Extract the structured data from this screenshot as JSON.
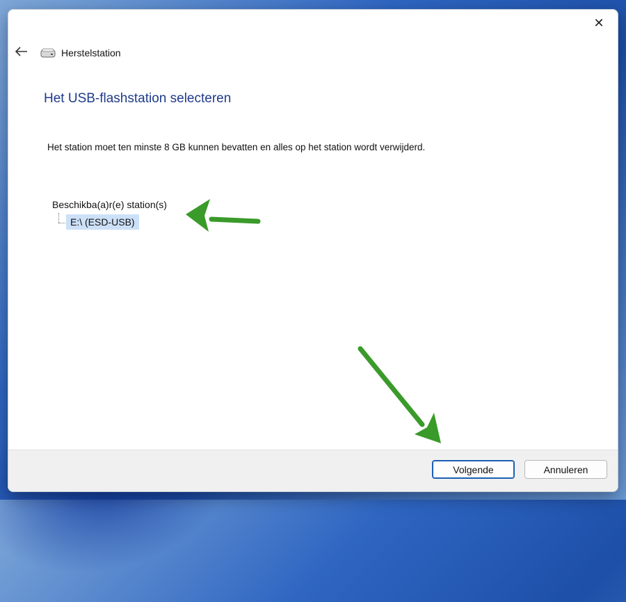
{
  "window": {
    "app_title": "Herstelstation",
    "close_glyph": "✕",
    "back_glyph": "←"
  },
  "page": {
    "heading": "Het USB-flashstation selecteren",
    "instruction": "Het station moet ten minste 8 GB kunnen bevatten en alles op het station wordt verwijderd."
  },
  "drives": {
    "root_label": "Beschikba(a)r(e) station(s)",
    "items": [
      {
        "label": "E:\\ (ESD-USB)",
        "selected": true
      }
    ]
  },
  "footer": {
    "next_label": "Volgende",
    "cancel_label": "Annuleren"
  },
  "icons": {
    "back": "arrow-left-icon",
    "close": "close-icon",
    "drive": "drive-icon",
    "annotation_arrows": "green-arrow-icon"
  },
  "colors": {
    "heading": "#1e3a8c",
    "selection": "#cce0f8",
    "primary_border": "#1a5fb4",
    "annotation_arrow": "#3a9a2a"
  }
}
